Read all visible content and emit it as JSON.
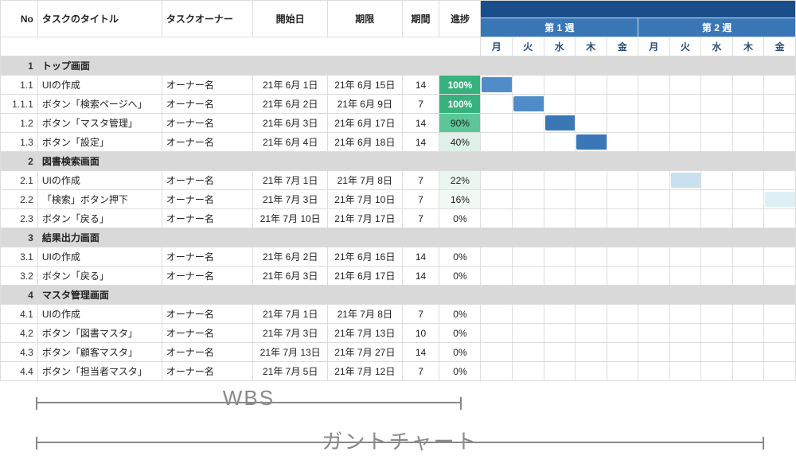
{
  "chart_data": {
    "type": "table",
    "title": "WBS / ガントチャート",
    "columns": [
      "No",
      "タスクのタイトル",
      "タスクオーナー",
      "開始日",
      "期限",
      "期間",
      "進捗"
    ],
    "weeks": [
      "第 1 週",
      "第 2 週"
    ],
    "days": [
      "月",
      "火",
      "水",
      "木",
      "金",
      "月",
      "火",
      "水",
      "木",
      "金"
    ],
    "rows": [
      {
        "no": "1",
        "title": "トップ画面",
        "group": true
      },
      {
        "no": "1.1",
        "title": "UIの作成",
        "owner": "オーナー名",
        "start": "21年 6月 1日",
        "end": "21年 6月 15日",
        "dur": "14",
        "prog": "100%",
        "bar": [
          0,
          2,
          "main"
        ]
      },
      {
        "no": "1.1.1",
        "title": "ボタン「検索ページへ」",
        "owner": "オーナー名",
        "start": "21年 6月 2日",
        "end": "21年 6月 9日",
        "dur": "7",
        "prog": "100%",
        "bar": [
          1,
          3,
          "main"
        ]
      },
      {
        "no": "1.2",
        "title": "ボタン「マスタ管理」",
        "owner": "オーナー名",
        "start": "21年 6月 3日",
        "end": "21年 6月 17日",
        "dur": "14",
        "prog": "90%",
        "bar": [
          2,
          9,
          "alt"
        ]
      },
      {
        "no": "1.3",
        "title": "ボタン「設定」",
        "owner": "オーナー名",
        "start": "21年 6月 4日",
        "end": "21年 6月 18日",
        "dur": "14",
        "prog": "40%",
        "bar": [
          3,
          10,
          "alt"
        ]
      },
      {
        "no": "2",
        "title": "図書検索画面",
        "group": true
      },
      {
        "no": "2.1",
        "title": "UIの作成",
        "owner": "オーナー名",
        "start": "21年 7月 1日",
        "end": "21年 7月 8日",
        "dur": "7",
        "prog": "22%",
        "bar": [
          6,
          9,
          "pale"
        ]
      },
      {
        "no": "2.2",
        "title": "「検索」ボタン押下",
        "owner": "オーナー名",
        "start": "21年 7月 3日",
        "end": "21年 7月 10日",
        "dur": "7",
        "prog": "16%",
        "bar": [
          9,
          10,
          "paler"
        ]
      },
      {
        "no": "2.3",
        "title": "ボタン「戻る」",
        "owner": "オーナー名",
        "start": "21年 7月 10日",
        "end": "21年 7月 17日",
        "dur": "7",
        "prog": "0%"
      },
      {
        "no": "3",
        "title": "結果出力画面",
        "group": true
      },
      {
        "no": "3.1",
        "title": "UIの作成",
        "owner": "オーナー名",
        "start": "21年 6月 2日",
        "end": "21年 6月 16日",
        "dur": "14",
        "prog": "0%"
      },
      {
        "no": "3.2",
        "title": "ボタン「戻る」",
        "owner": "オーナー名",
        "start": "21年 6月 3日",
        "end": "21年 6月 17日",
        "dur": "14",
        "prog": "0%"
      },
      {
        "no": "4",
        "title": "マスタ管理画面",
        "group": true
      },
      {
        "no": "4.1",
        "title": "UIの作成",
        "owner": "オーナー名",
        "start": "21年 7月 1日",
        "end": "21年 7月 8日",
        "dur": "7",
        "prog": "0%"
      },
      {
        "no": "4.2",
        "title": "ボタン「図書マスタ」",
        "owner": "オーナー名",
        "start": "21年 7月 3日",
        "end": "21年 7月 13日",
        "dur": "10",
        "prog": "0%"
      },
      {
        "no": "4.3",
        "title": "ボタン「顧客マスタ」",
        "owner": "オーナー名",
        "start": "21年 7月 13日",
        "end": "21年 7月 27日",
        "dur": "14",
        "prog": "0%"
      },
      {
        "no": "4.4",
        "title": "ボタン「担当者マスタ」",
        "owner": "オーナー名",
        "start": "21年 7月 5日",
        "end": "21年 7月 12日",
        "dur": "7",
        "prog": "0%"
      }
    ]
  },
  "labels": {
    "wbs": "WBS",
    "gantt": "ガントチャート"
  }
}
